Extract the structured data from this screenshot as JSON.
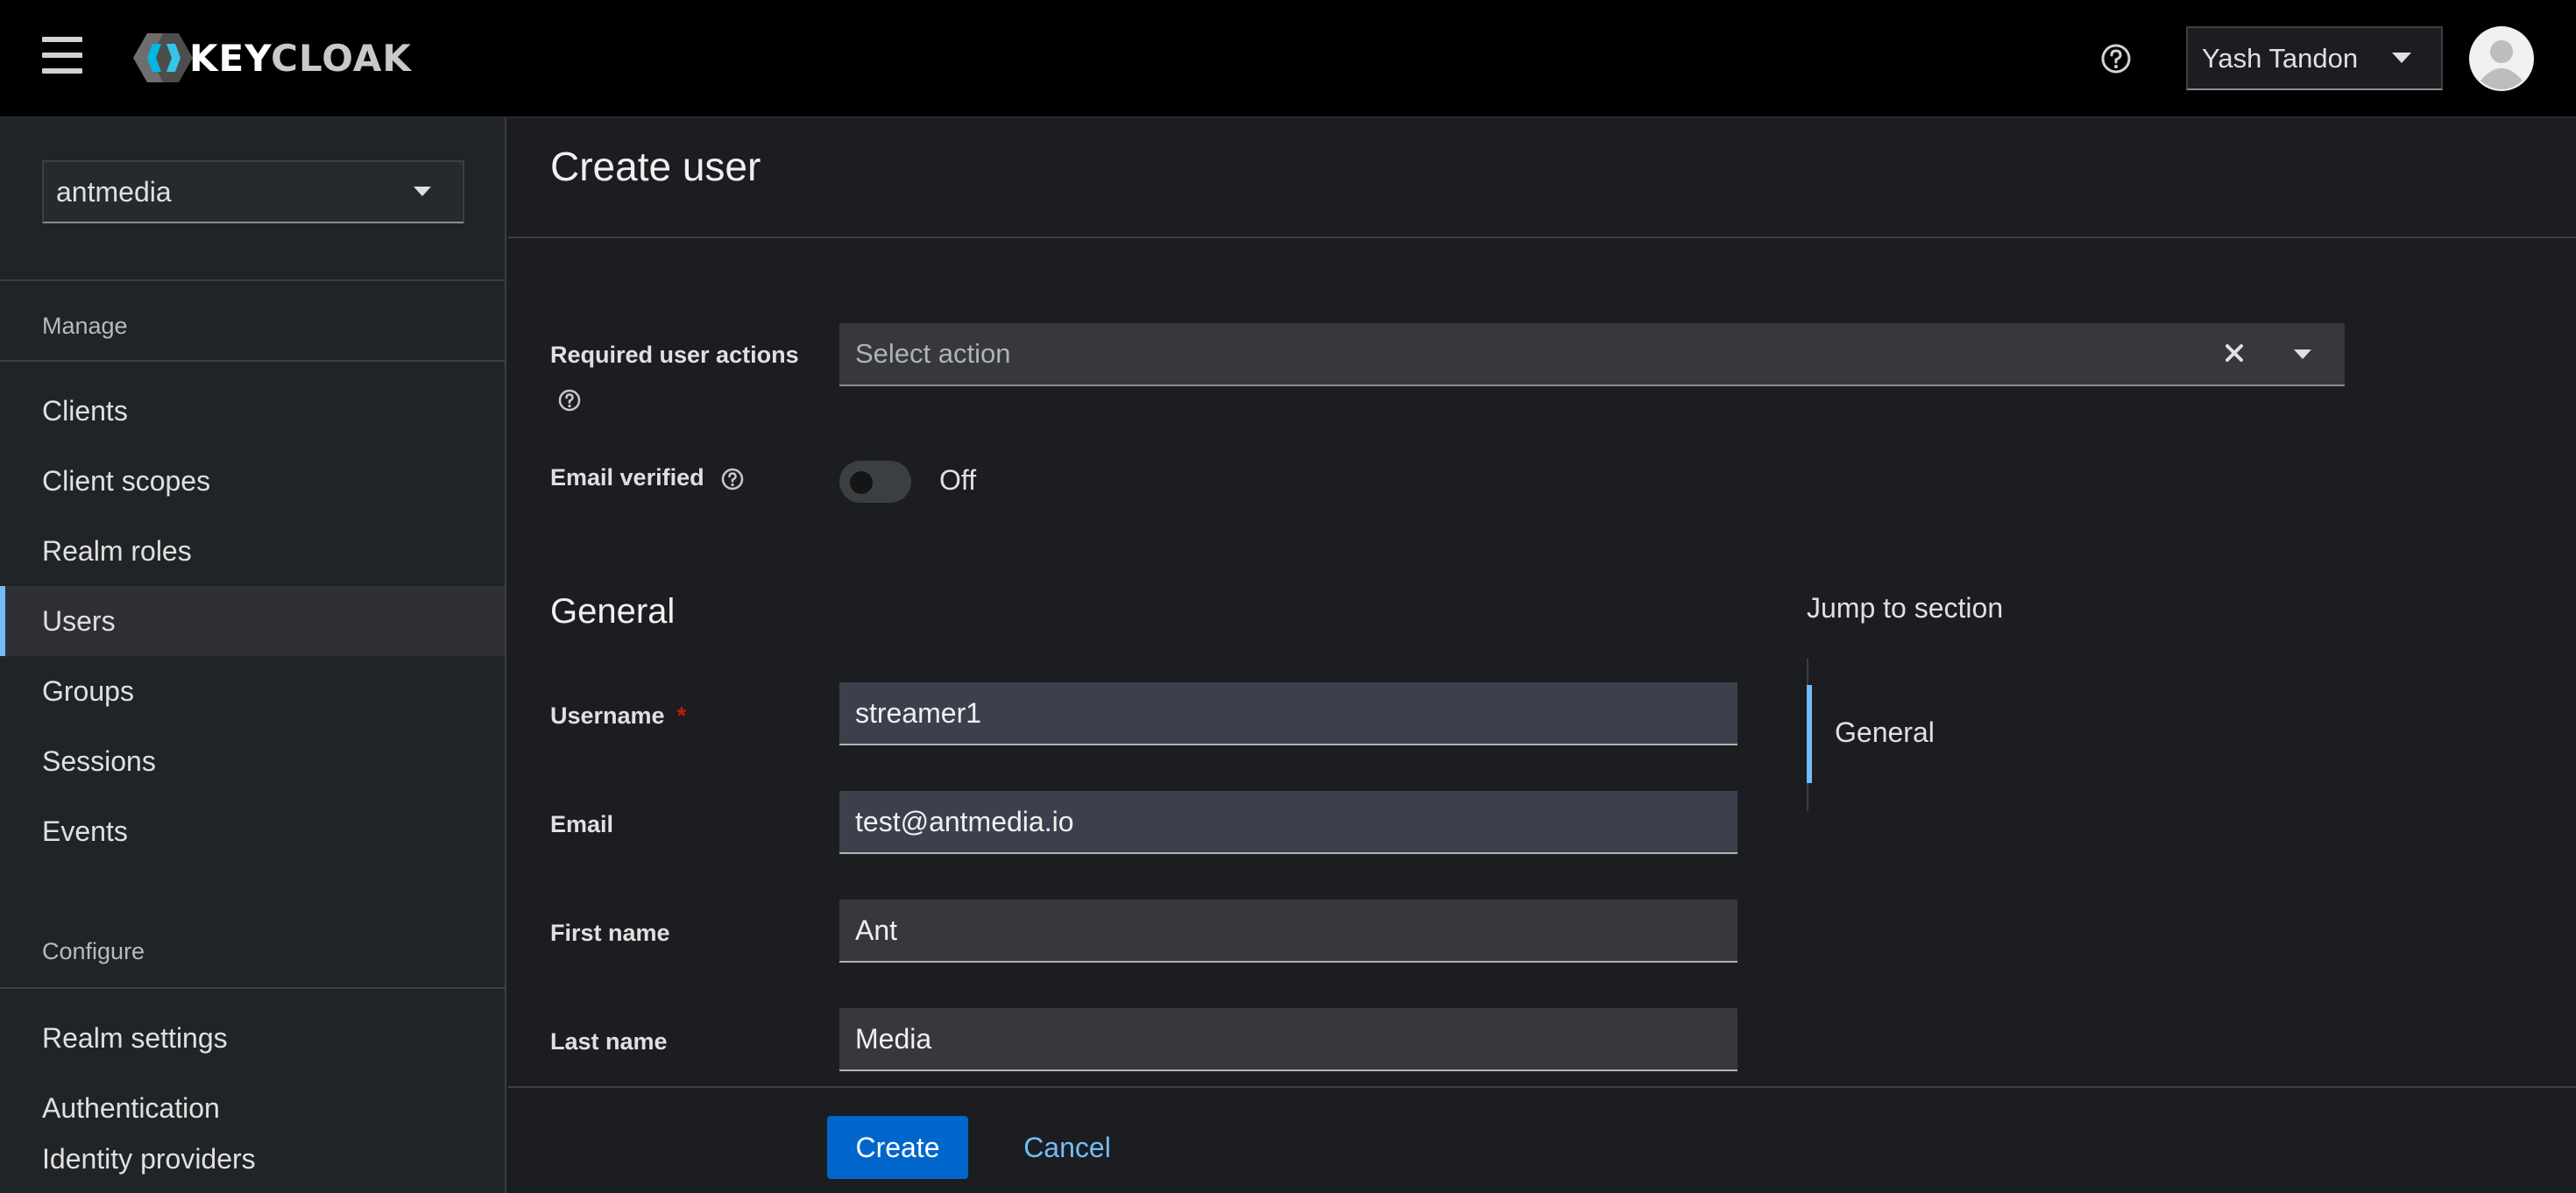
{
  "header": {
    "logo_text_left": "KEY",
    "logo_text_right": "CLOAK",
    "user_name": "Yash Tandon"
  },
  "sidebar": {
    "realm": "antmedia",
    "manage_label": "Manage",
    "manage_items": [
      {
        "label": "Clients"
      },
      {
        "label": "Client scopes"
      },
      {
        "label": "Realm roles"
      },
      {
        "label": "Users",
        "active": true
      },
      {
        "label": "Groups"
      },
      {
        "label": "Sessions"
      },
      {
        "label": "Events"
      }
    ],
    "configure_label": "Configure",
    "configure_items": [
      {
        "label": "Realm settings"
      },
      {
        "label": "Authentication"
      },
      {
        "label": "Identity providers"
      }
    ]
  },
  "page": {
    "title": "Create user",
    "required_actions_label": "Required user actions",
    "required_actions_placeholder": "Select action",
    "email_verified_label": "Email verified",
    "email_verified_state": "Off",
    "general_title": "General",
    "fields": {
      "username": {
        "label": "Username",
        "required_mark": "*",
        "value": "streamer1"
      },
      "email": {
        "label": "Email",
        "value": "test@antmedia.io"
      },
      "first_name": {
        "label": "First name",
        "value": "Ant"
      },
      "last_name": {
        "label": "Last name",
        "value": "Media"
      }
    },
    "jump_title": "Jump to section",
    "jump_links": [
      {
        "label": "General"
      }
    ],
    "create_label": "Create",
    "cancel_label": "Cancel"
  },
  "colors": {
    "accent": "#73bcf7",
    "primary_button": "#0066cc",
    "required": "#c9190b"
  }
}
